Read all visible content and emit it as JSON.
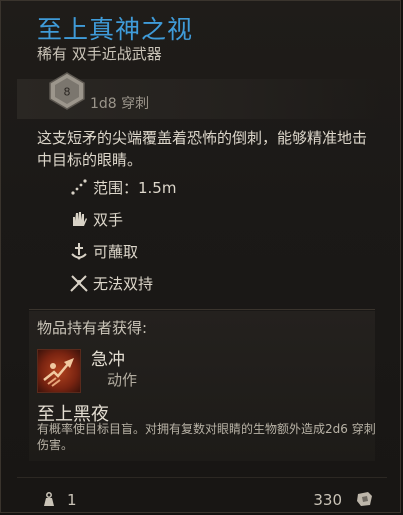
{
  "item": {
    "name": "至上真神之视",
    "subtitle": "稀有 双手近战武器",
    "die": "8",
    "damage": "1d8 穿刺",
    "description": "这支短矛的尖端覆盖着恐怖的倒刺，能够精准地击中目标的眼睛。",
    "properties": [
      {
        "label": "范围：1.5m",
        "icon": "reach-icon"
      },
      {
        "label": "双手",
        "icon": "two-hand-icon"
      },
      {
        "label": "可蘸取",
        "icon": "dippable-icon"
      },
      {
        "label": "无法双持",
        "icon": "no-dual-wield-icon"
      }
    ]
  },
  "granted": {
    "header": "物品持有者获得:",
    "action_name": "急冲",
    "action_type": "动作",
    "passive_name": "至上黑夜",
    "passive_desc": "有概率使目标目盲。对拥有复数对眼睛的生物额外造成2d6 穿刺伤害。"
  },
  "footer": {
    "weight": "1",
    "price": "330"
  },
  "colors": {
    "title": "#3f9bd8",
    "action_icon": "#b3431f"
  }
}
